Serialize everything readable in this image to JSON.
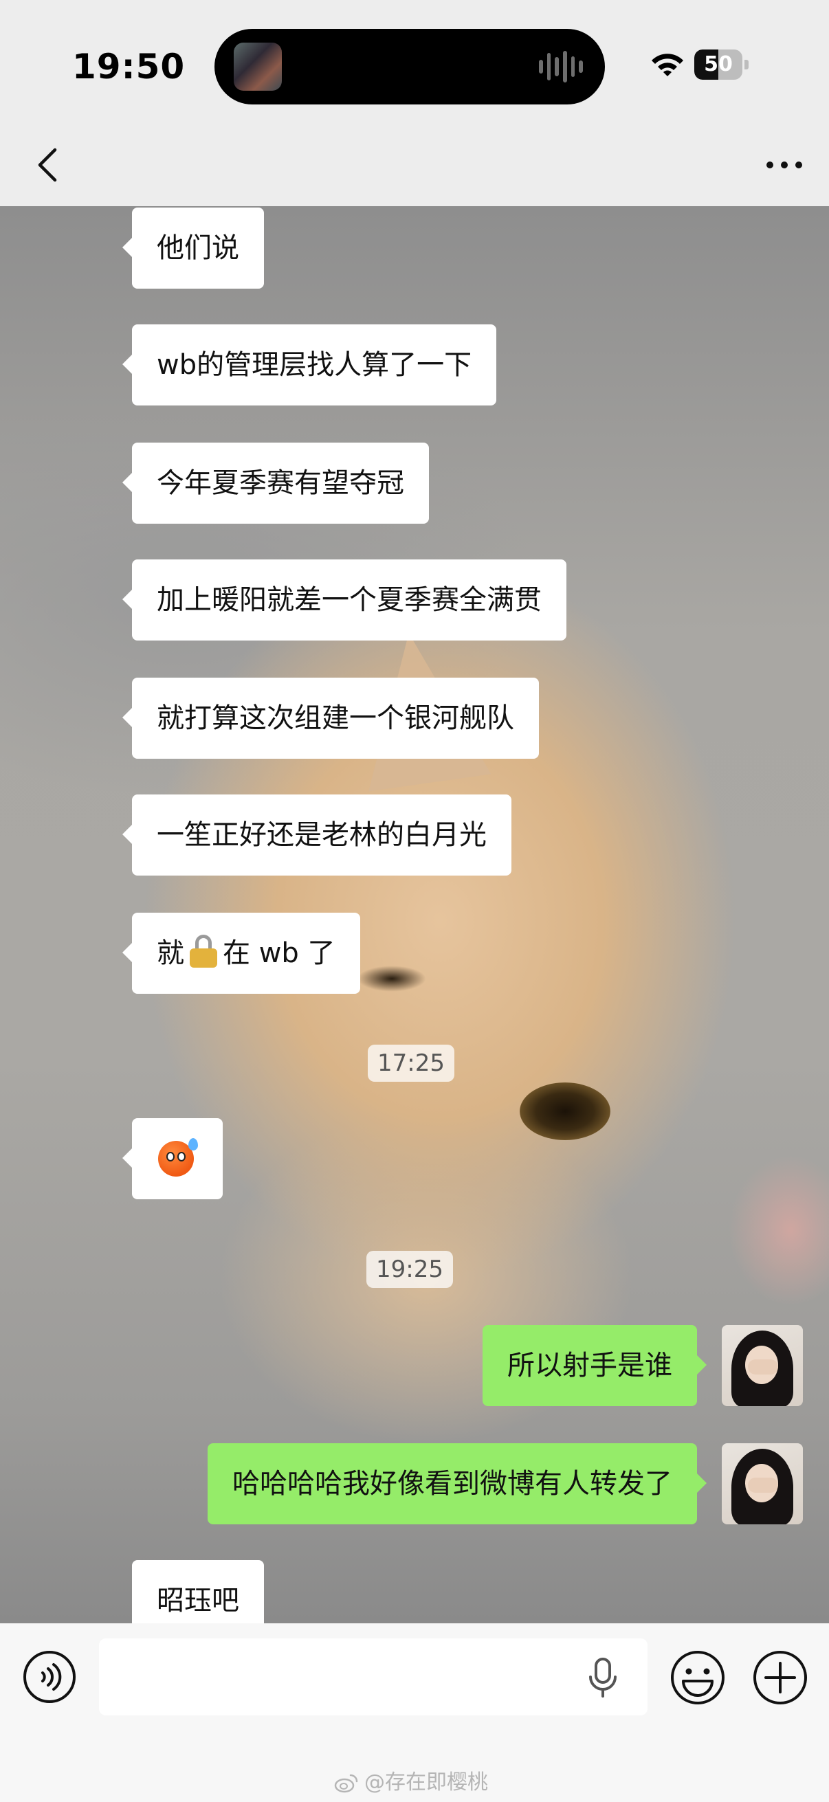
{
  "status_bar": {
    "time": "19:50",
    "battery_level": "50",
    "battery_fraction": 0.5
  },
  "nav": {
    "back": "back",
    "more": "more"
  },
  "messages": [
    {
      "text": "他们说",
      "side": "in"
    },
    {
      "text": "wb的管理层找人算了一下",
      "side": "in"
    },
    {
      "text": "今年夏季赛有望夺冠",
      "side": "in"
    },
    {
      "text": "加上暖阳就差一个夏季赛全满贯",
      "side": "in"
    },
    {
      "text": "就打算这次组建一个银河舰队",
      "side": "in"
    },
    {
      "text": "一笙正好还是老林的白月光",
      "side": "in"
    },
    {
      "text_before": "就",
      "text_after": "在 wb 了",
      "icon": "lock-icon",
      "side": "in"
    },
    {
      "timestamp": "17:25"
    },
    {
      "icon": "sweat-face-emoji",
      "side": "in"
    },
    {
      "timestamp": "19:25"
    },
    {
      "text": "所以射手是谁",
      "side": "out"
    },
    {
      "text": "哈哈哈哈我好像看到微博有人转发了",
      "side": "out"
    },
    {
      "text": "昭珏吧",
      "side": "in"
    }
  ],
  "input": {
    "value": "",
    "placeholder": ""
  },
  "watermark": "@存在即樱桃"
}
